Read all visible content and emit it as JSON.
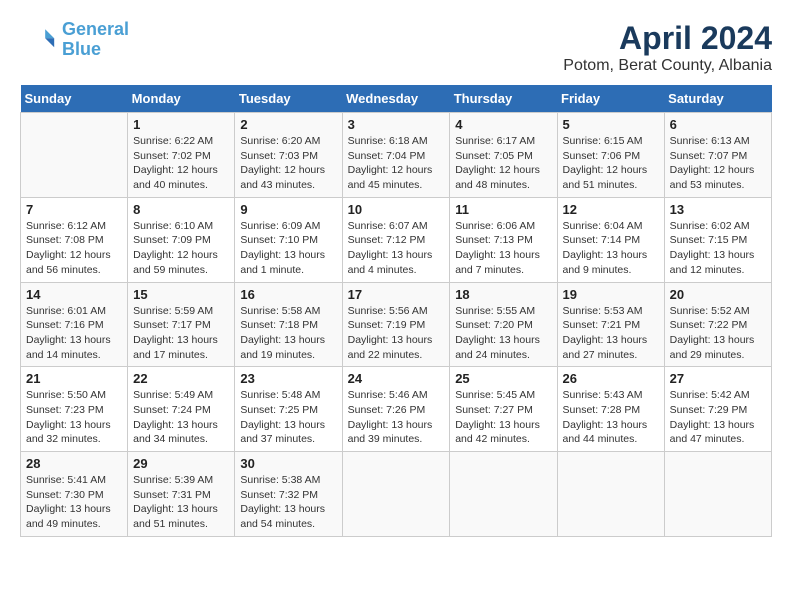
{
  "logo": {
    "line1": "General",
    "line2": "Blue"
  },
  "title": "April 2024",
  "location": "Potom, Berat County, Albania",
  "days_of_week": [
    "Sunday",
    "Monday",
    "Tuesday",
    "Wednesday",
    "Thursday",
    "Friday",
    "Saturday"
  ],
  "weeks": [
    [
      {
        "day": "",
        "info": ""
      },
      {
        "day": "1",
        "info": "Sunrise: 6:22 AM\nSunset: 7:02 PM\nDaylight: 12 hours\nand 40 minutes."
      },
      {
        "day": "2",
        "info": "Sunrise: 6:20 AM\nSunset: 7:03 PM\nDaylight: 12 hours\nand 43 minutes."
      },
      {
        "day": "3",
        "info": "Sunrise: 6:18 AM\nSunset: 7:04 PM\nDaylight: 12 hours\nand 45 minutes."
      },
      {
        "day": "4",
        "info": "Sunrise: 6:17 AM\nSunset: 7:05 PM\nDaylight: 12 hours\nand 48 minutes."
      },
      {
        "day": "5",
        "info": "Sunrise: 6:15 AM\nSunset: 7:06 PM\nDaylight: 12 hours\nand 51 minutes."
      },
      {
        "day": "6",
        "info": "Sunrise: 6:13 AM\nSunset: 7:07 PM\nDaylight: 12 hours\nand 53 minutes."
      }
    ],
    [
      {
        "day": "7",
        "info": "Sunrise: 6:12 AM\nSunset: 7:08 PM\nDaylight: 12 hours\nand 56 minutes."
      },
      {
        "day": "8",
        "info": "Sunrise: 6:10 AM\nSunset: 7:09 PM\nDaylight: 12 hours\nand 59 minutes."
      },
      {
        "day": "9",
        "info": "Sunrise: 6:09 AM\nSunset: 7:10 PM\nDaylight: 13 hours\nand 1 minute."
      },
      {
        "day": "10",
        "info": "Sunrise: 6:07 AM\nSunset: 7:12 PM\nDaylight: 13 hours\nand 4 minutes."
      },
      {
        "day": "11",
        "info": "Sunrise: 6:06 AM\nSunset: 7:13 PM\nDaylight: 13 hours\nand 7 minutes."
      },
      {
        "day": "12",
        "info": "Sunrise: 6:04 AM\nSunset: 7:14 PM\nDaylight: 13 hours\nand 9 minutes."
      },
      {
        "day": "13",
        "info": "Sunrise: 6:02 AM\nSunset: 7:15 PM\nDaylight: 13 hours\nand 12 minutes."
      }
    ],
    [
      {
        "day": "14",
        "info": "Sunrise: 6:01 AM\nSunset: 7:16 PM\nDaylight: 13 hours\nand 14 minutes."
      },
      {
        "day": "15",
        "info": "Sunrise: 5:59 AM\nSunset: 7:17 PM\nDaylight: 13 hours\nand 17 minutes."
      },
      {
        "day": "16",
        "info": "Sunrise: 5:58 AM\nSunset: 7:18 PM\nDaylight: 13 hours\nand 19 minutes."
      },
      {
        "day": "17",
        "info": "Sunrise: 5:56 AM\nSunset: 7:19 PM\nDaylight: 13 hours\nand 22 minutes."
      },
      {
        "day": "18",
        "info": "Sunrise: 5:55 AM\nSunset: 7:20 PM\nDaylight: 13 hours\nand 24 minutes."
      },
      {
        "day": "19",
        "info": "Sunrise: 5:53 AM\nSunset: 7:21 PM\nDaylight: 13 hours\nand 27 minutes."
      },
      {
        "day": "20",
        "info": "Sunrise: 5:52 AM\nSunset: 7:22 PM\nDaylight: 13 hours\nand 29 minutes."
      }
    ],
    [
      {
        "day": "21",
        "info": "Sunrise: 5:50 AM\nSunset: 7:23 PM\nDaylight: 13 hours\nand 32 minutes."
      },
      {
        "day": "22",
        "info": "Sunrise: 5:49 AM\nSunset: 7:24 PM\nDaylight: 13 hours\nand 34 minutes."
      },
      {
        "day": "23",
        "info": "Sunrise: 5:48 AM\nSunset: 7:25 PM\nDaylight: 13 hours\nand 37 minutes."
      },
      {
        "day": "24",
        "info": "Sunrise: 5:46 AM\nSunset: 7:26 PM\nDaylight: 13 hours\nand 39 minutes."
      },
      {
        "day": "25",
        "info": "Sunrise: 5:45 AM\nSunset: 7:27 PM\nDaylight: 13 hours\nand 42 minutes."
      },
      {
        "day": "26",
        "info": "Sunrise: 5:43 AM\nSunset: 7:28 PM\nDaylight: 13 hours\nand 44 minutes."
      },
      {
        "day": "27",
        "info": "Sunrise: 5:42 AM\nSunset: 7:29 PM\nDaylight: 13 hours\nand 47 minutes."
      }
    ],
    [
      {
        "day": "28",
        "info": "Sunrise: 5:41 AM\nSunset: 7:30 PM\nDaylight: 13 hours\nand 49 minutes."
      },
      {
        "day": "29",
        "info": "Sunrise: 5:39 AM\nSunset: 7:31 PM\nDaylight: 13 hours\nand 51 minutes."
      },
      {
        "day": "30",
        "info": "Sunrise: 5:38 AM\nSunset: 7:32 PM\nDaylight: 13 hours\nand 54 minutes."
      },
      {
        "day": "",
        "info": ""
      },
      {
        "day": "",
        "info": ""
      },
      {
        "day": "",
        "info": ""
      },
      {
        "day": "",
        "info": ""
      }
    ]
  ]
}
